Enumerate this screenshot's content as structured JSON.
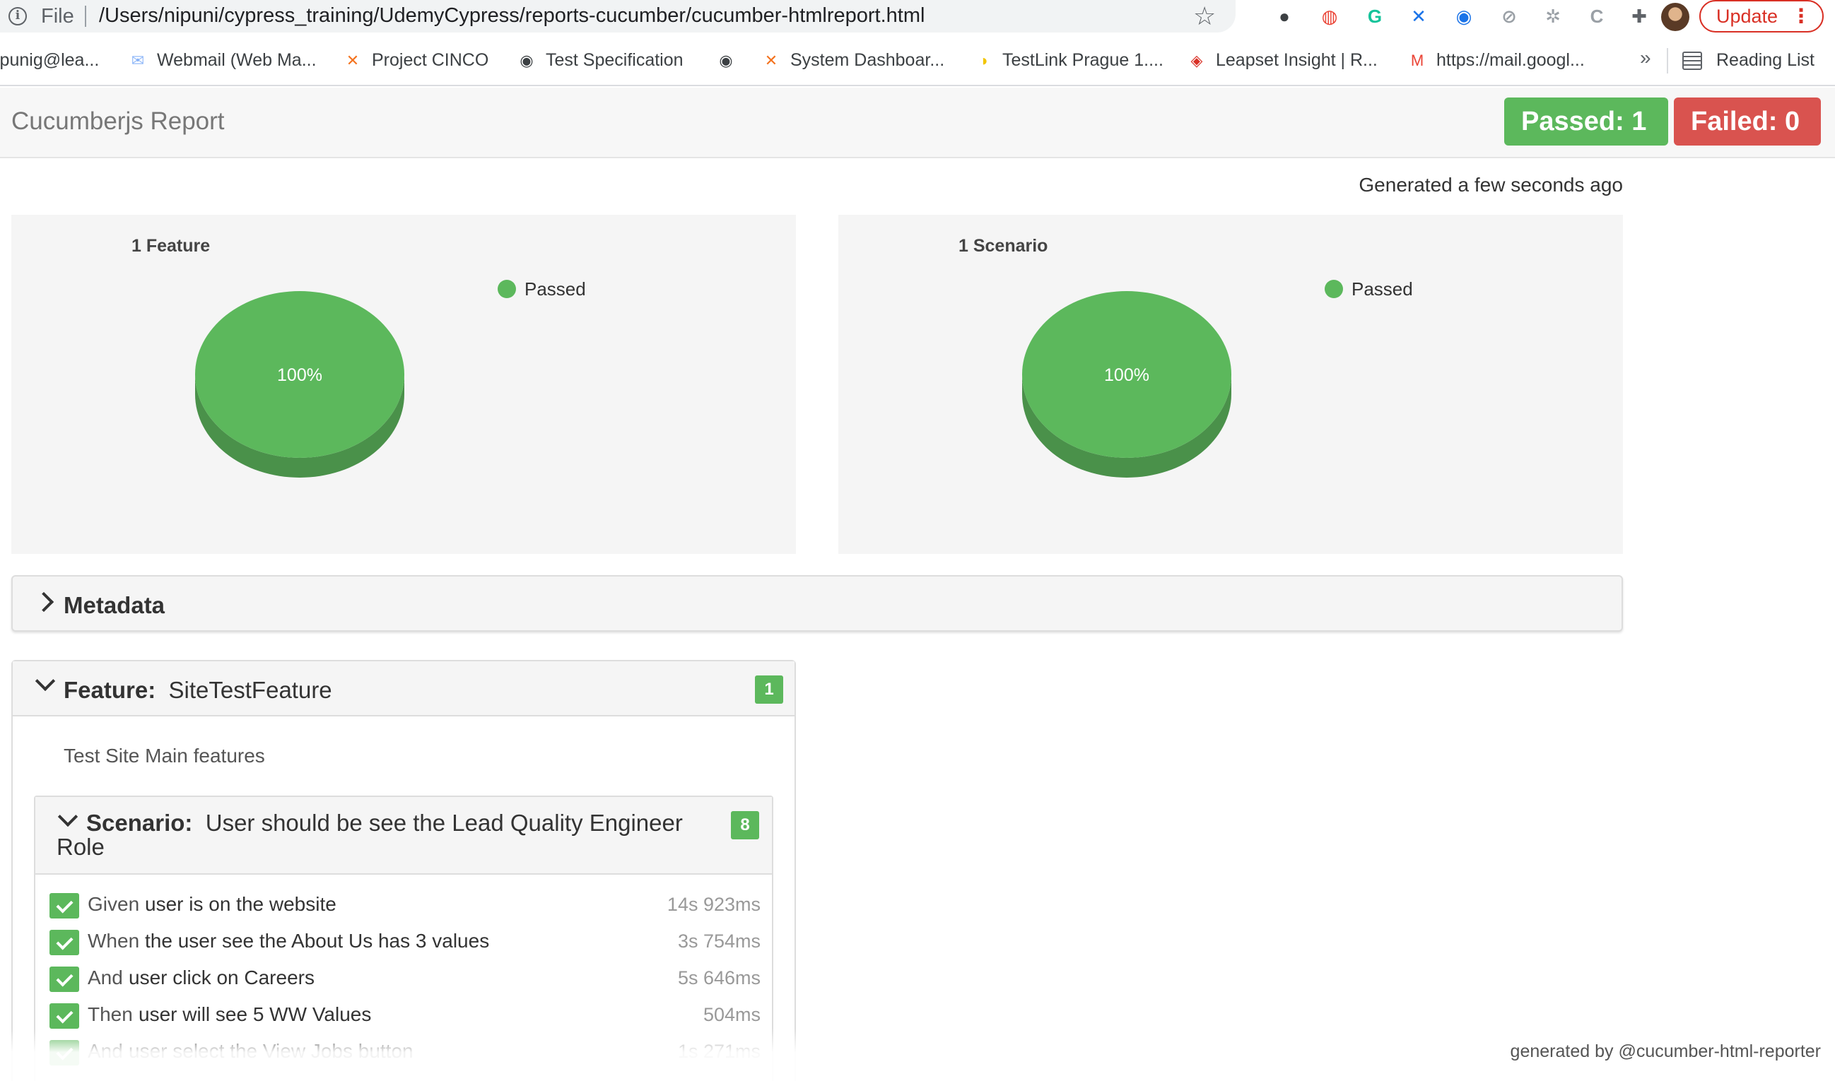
{
  "browser": {
    "file_label": "File",
    "url": "/Users/nipuni/cypress_training/UdemyCypress/reports-cucumber/cucumber-htmlreport.html",
    "update_label": "Update",
    "extensions": [
      {
        "name": "dark-circle-extension-icon",
        "color": "#3c4043",
        "glyph": "●"
      },
      {
        "name": "headphones-extension-icon",
        "color": "#ea4335",
        "glyph": "◍"
      },
      {
        "name": "grammarly-extension-icon",
        "color": "#15c39a",
        "glyph": "G"
      },
      {
        "name": "circle-x-extension-icon",
        "color": "#1a73e8",
        "glyph": "✕"
      },
      {
        "name": "screen-record-extension-icon",
        "color": "#1a73e8",
        "glyph": "◉"
      },
      {
        "name": "speed-extension-icon",
        "color": "#9aa0a6",
        "glyph": "⊘"
      },
      {
        "name": "bug-extension-icon",
        "color": "#9aa0a6",
        "glyph": "✲"
      },
      {
        "name": "code-extension-icon",
        "color": "#9aa0a6",
        "glyph": "C"
      },
      {
        "name": "puzzle-extension-icon",
        "color": "#5f6368",
        "glyph": "✚"
      }
    ],
    "bookmarks": [
      {
        "label": "ipunig@lea...",
        "icon": "none",
        "icon_color": "#5f6368"
      },
      {
        "label": "Webmail (Web Ma...",
        "icon": "envelope-icon",
        "icon_color": "#8ab4f8"
      },
      {
        "label": "Project CINCO",
        "icon": "jira-icon",
        "icon_color": "#f4731f"
      },
      {
        "label": "Test Specification",
        "icon": "globe-icon",
        "icon_color": "#3c4043"
      },
      {
        "label": "",
        "icon": "globe-icon",
        "icon_color": "#3c4043"
      },
      {
        "label": "System Dashboar...",
        "icon": "jira-icon",
        "icon_color": "#f4731f"
      },
      {
        "label": "TestLink Prague 1....",
        "icon": "testlink-icon",
        "icon_color": "#f2c500"
      },
      {
        "label": "Leapset Insight | R...",
        "icon": "leapset-icon",
        "icon_color": "#d93025"
      },
      {
        "label": "https://mail.googl...",
        "icon": "gmail-icon",
        "icon_color": "#ea4335"
      }
    ],
    "more_label": "»",
    "reading_list": "Reading List"
  },
  "report": {
    "title": "Cucumberjs Report",
    "passed_label": "Passed: 1",
    "failed_label": "Failed: 0",
    "generated": "Generated a few seconds ago",
    "metadata_label": "Metadata",
    "footer": "generated by @cucumber-html-reporter"
  },
  "colors": {
    "passed": "#5cb85c",
    "failed": "#d9534f"
  },
  "chart_data": [
    {
      "type": "pie",
      "title": "1 Feature",
      "labels": [
        "Passed"
      ],
      "values": [
        100
      ],
      "slice_labels": [
        "100%"
      ],
      "legend": [
        "Passed"
      ],
      "colors": [
        "#5cb85c"
      ]
    },
    {
      "type": "pie",
      "title": "1 Scenario",
      "labels": [
        "Passed"
      ],
      "values": [
        100
      ],
      "slice_labels": [
        "100%"
      ],
      "legend": [
        "Passed"
      ],
      "colors": [
        "#5cb85c"
      ]
    }
  ],
  "feature": {
    "keyword": "Feature:",
    "name": "SiteTestFeature",
    "count": "1",
    "description": "Test Site Main features",
    "scenario": {
      "keyword": "Scenario:",
      "name": "User should be see the Lead Quality Engineer Role",
      "count": "8",
      "steps": [
        {
          "keyword": "Given",
          "text": "user is on the website",
          "duration": "14s 923ms"
        },
        {
          "keyword": "When",
          "text": "the user see the About Us has 3 values",
          "duration": "3s 754ms"
        },
        {
          "keyword": "And",
          "text": "user click on Careers",
          "duration": "5s 646ms"
        },
        {
          "keyword": "Then",
          "text": "user will see 5 WW Values",
          "duration": "504ms"
        },
        {
          "keyword": "And",
          "text": "user select the View Jobs button",
          "duration": "1s 271ms"
        }
      ]
    }
  }
}
